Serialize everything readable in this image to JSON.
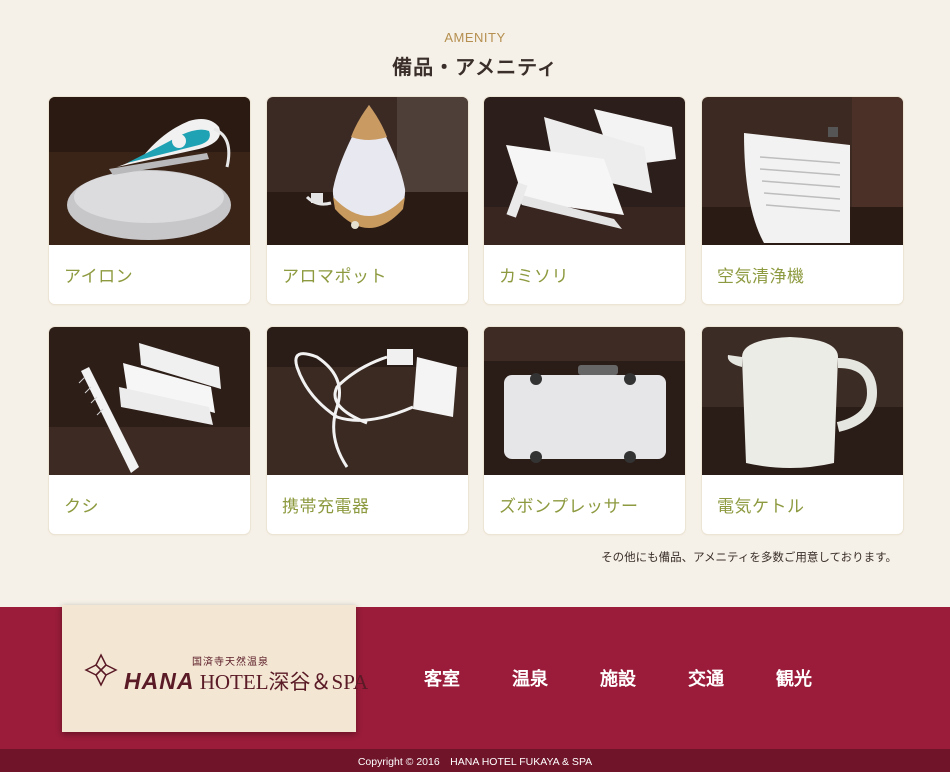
{
  "section": {
    "eyebrow": "AMENITY",
    "title": "備品・アメニティ"
  },
  "amenities": [
    {
      "label": "アイロン"
    },
    {
      "label": "アロマポット"
    },
    {
      "label": "カミソリ"
    },
    {
      "label": "空気清浄機"
    },
    {
      "label": "クシ"
    },
    {
      "label": "携帯充電器"
    },
    {
      "label": "ズボンプレッサー"
    },
    {
      "label": "電気ケトル"
    }
  ],
  "note": "その他にも備品、アメニティを多数ご用意しております。",
  "footer": {
    "logo": {
      "subtitle": "国済寺天然温泉",
      "brand": "HANA",
      "name": "HOTEL深谷＆SPA"
    },
    "nav": [
      {
        "label": "客室"
      },
      {
        "label": "温泉"
      },
      {
        "label": "施設"
      },
      {
        "label": "交通"
      },
      {
        "label": "観光"
      }
    ],
    "copyright": "Copyright © 2016　HANA HOTEL FUKAYA & SPA"
  },
  "colors": {
    "background": "#f6f1e8",
    "accent_gold": "#b58f4f",
    "label_green": "#8e9a3f",
    "footer_red": "#9a1c3a",
    "copyright_bar": "#6f1429",
    "logo_bg": "#f3e6d3"
  }
}
